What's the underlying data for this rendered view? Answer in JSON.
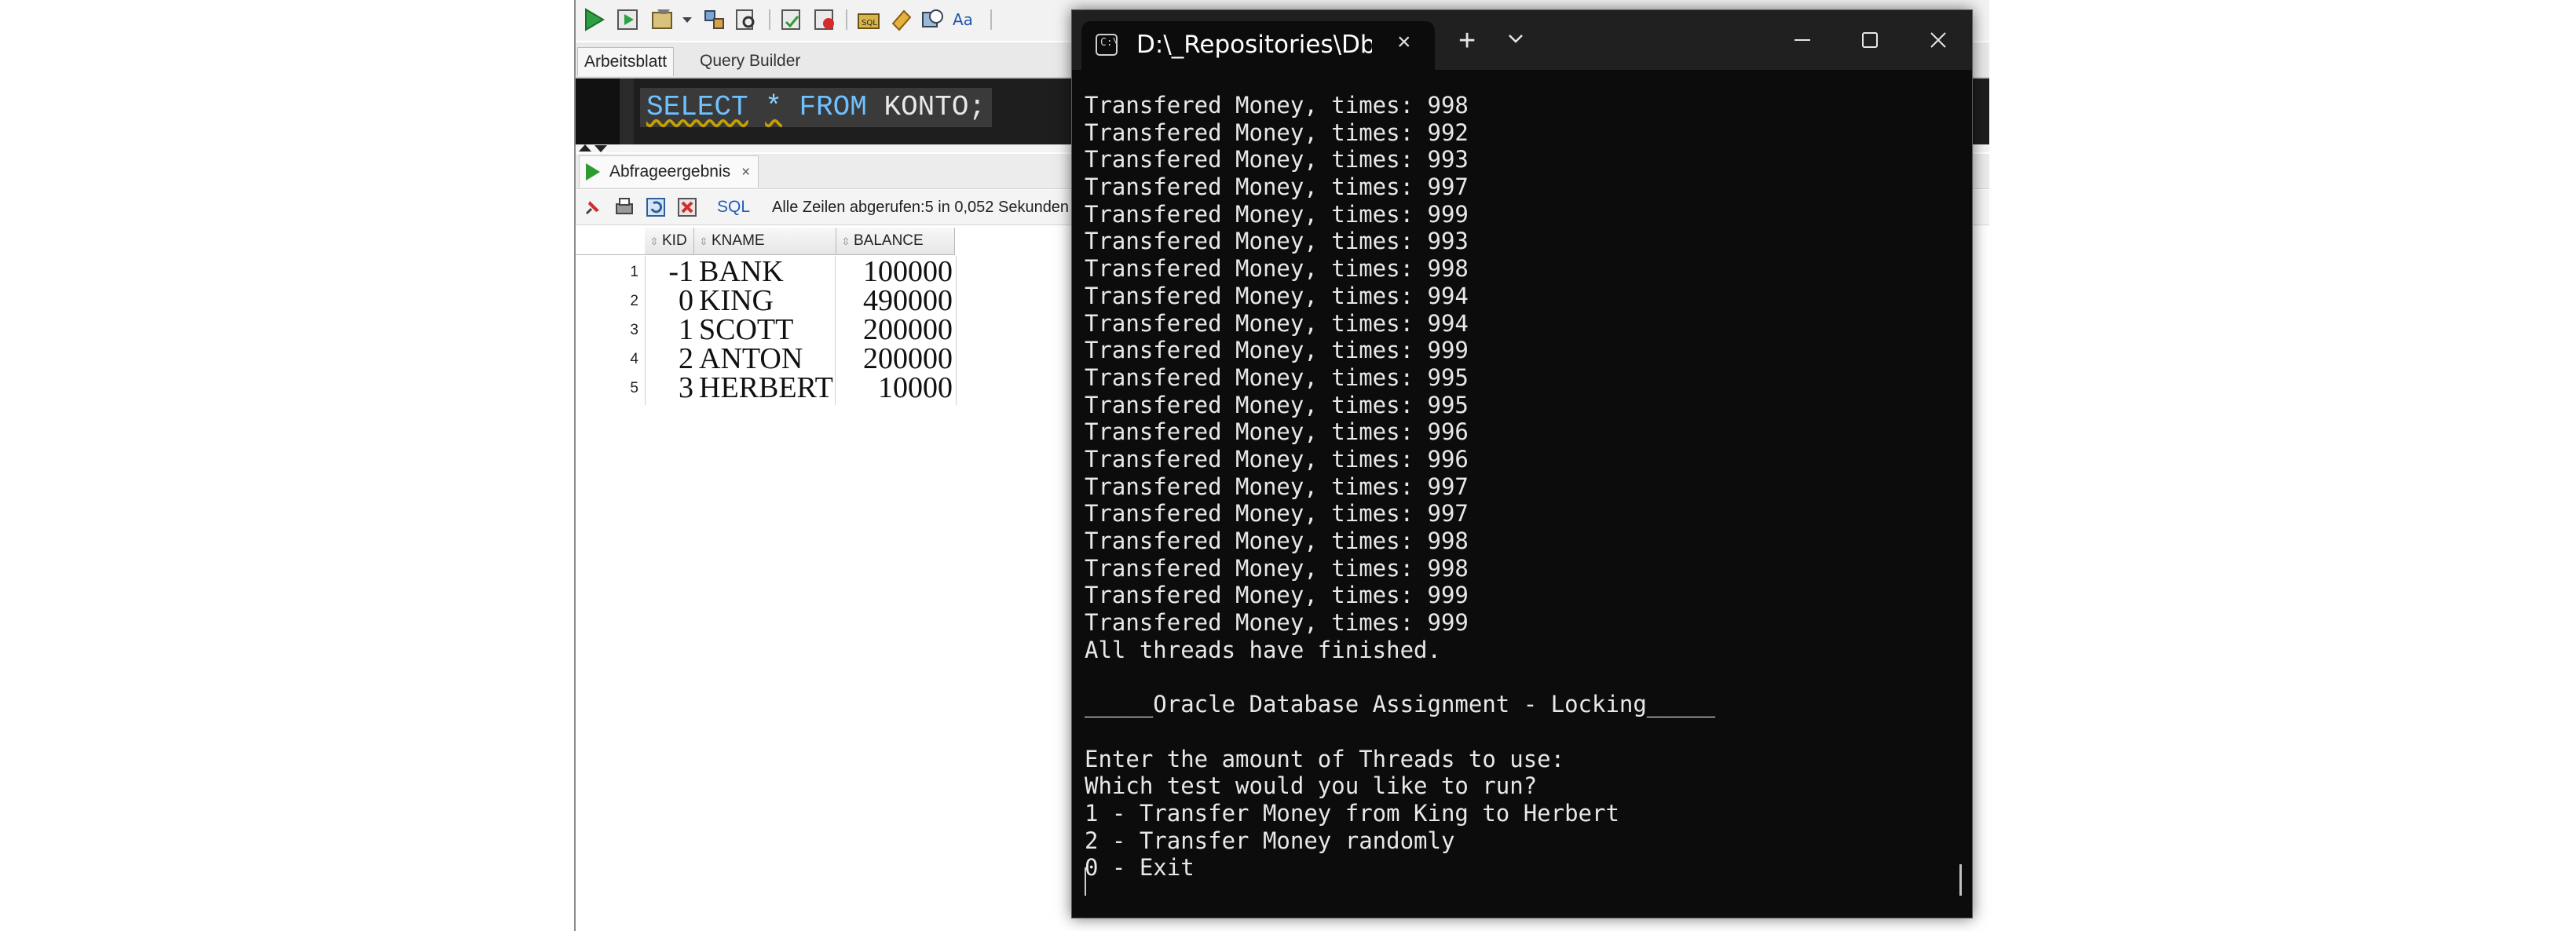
{
  "sqldev": {
    "editor_tabs": [
      "Arbeitsblatt",
      "Query Builder"
    ],
    "sql_tokens": [
      {
        "text": "SELECT",
        "kind": "keyword"
      },
      {
        "text": " ",
        "kind": "plain"
      },
      {
        "text": "*",
        "kind": "star"
      },
      {
        "text": " ",
        "kind": "plain"
      },
      {
        "text": "FROM",
        "kind": "keyword"
      },
      {
        "text": " KONTO;",
        "kind": "plain"
      }
    ],
    "results_tab": {
      "label": "Abfrageergebnis",
      "close": "×"
    },
    "results_toolbar": {
      "sql_label": "SQL",
      "status": "Alle Zeilen abgerufen:5 in 0,052 Sekunden"
    },
    "grid": {
      "columns": [
        "KID",
        "KNAME",
        "BALANCE"
      ],
      "rows": [
        {
          "n": "1",
          "kid": "-1",
          "kname": "BANK",
          "balance": "100000"
        },
        {
          "n": "2",
          "kid": "0",
          "kname": "KING",
          "balance": "490000"
        },
        {
          "n": "3",
          "kid": "1",
          "kname": "SCOTT",
          "balance": "200000"
        },
        {
          "n": "4",
          "kid": "2",
          "kname": "ANTON",
          "balance": "200000"
        },
        {
          "n": "5",
          "kid": "3",
          "kname": "HERBERT",
          "balance": "10000"
        }
      ]
    }
  },
  "terminal": {
    "tab_title": "D:\\_Repositories\\DbiUe",
    "tab_close": "×",
    "new_tab": "+",
    "output_lines": [
      "Transfered Money, times: 998",
      "Transfered Money, times: 992",
      "Transfered Money, times: 993",
      "Transfered Money, times: 997",
      "Transfered Money, times: 999",
      "Transfered Money, times: 993",
      "Transfered Money, times: 998",
      "Transfered Money, times: 994",
      "Transfered Money, times: 994",
      "Transfered Money, times: 999",
      "Transfered Money, times: 995",
      "Transfered Money, times: 995",
      "Transfered Money, times: 996",
      "Transfered Money, times: 996",
      "Transfered Money, times: 997",
      "Transfered Money, times: 997",
      "Transfered Money, times: 998",
      "Transfered Money, times: 998",
      "Transfered Money, times: 999",
      "Transfered Money, times: 999",
      "All threads have finished.",
      "",
      "_____Oracle Database Assignment - Locking_____",
      "",
      "Enter the amount of Threads to use:",
      "Which test would you like to run?",
      "1 - Transfer Money from King to Herbert",
      "2 - Transfer Money randomly",
      "0 - Exit"
    ]
  }
}
